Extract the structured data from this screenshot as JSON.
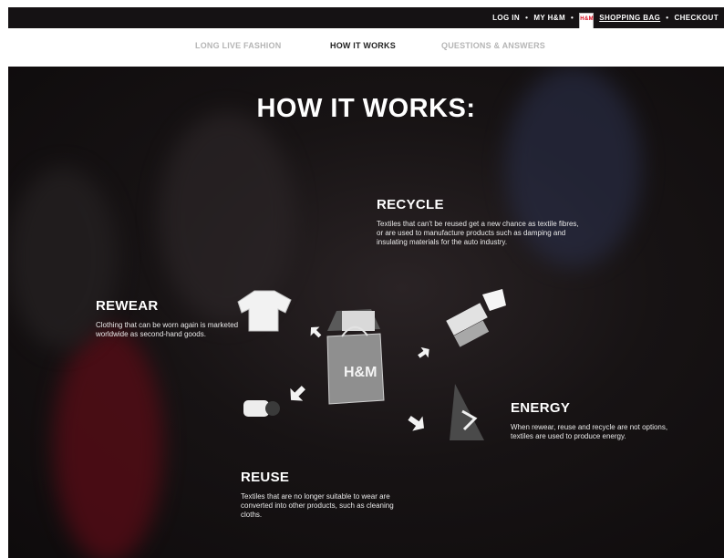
{
  "top_nav": {
    "log_in": "LOG IN",
    "my_hm": "MY H&M",
    "shopping_bag": "SHOPPING BAG",
    "checkout": "CHECKOUT",
    "separator": "•",
    "bag_logo": "H&M"
  },
  "sub_nav": {
    "tabs": [
      {
        "label": "LONG LIVE FASHION"
      },
      {
        "label": "HOW IT WORKS"
      },
      {
        "label": "QUESTIONS & ANSWERS"
      }
    ]
  },
  "hero": {
    "title": "HOW IT WORKS:",
    "bag_logo": "H&M",
    "sections": {
      "recycle": {
        "heading": "RECYCLE",
        "text": "Textiles that can't be reused get a new chance as textile fibres, or are used to manufacture products such as damping and insulating materials for the auto industry."
      },
      "rewear": {
        "heading": "REWEAR",
        "text": "Clothing that can be worn again is marketed worldwide as second-hand goods."
      },
      "energy": {
        "heading": "ENERGY",
        "text": "When rewear, reuse and recycle are not options, textiles are used to produce energy."
      },
      "reuse": {
        "heading": "REUSE",
        "text": "Textiles that are no longer suitable to wear are converted into other products, such as cleaning cloths."
      }
    }
  },
  "colors": {
    "top_bar": "#151214",
    "brand_red": "#d8071a",
    "hero_background": "#171314",
    "active_tab": "#222222",
    "inactive_tab": "#b5b5b5"
  }
}
